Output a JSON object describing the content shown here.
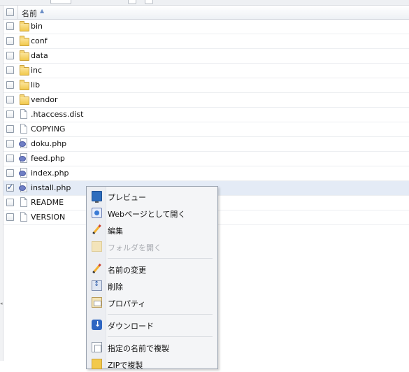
{
  "header": {
    "name_column": "名前",
    "sort_indicator": "▲"
  },
  "files": [
    {
      "name": "bin",
      "type": "folder",
      "checked": false
    },
    {
      "name": "conf",
      "type": "folder",
      "checked": false
    },
    {
      "name": "data",
      "type": "folder",
      "checked": false
    },
    {
      "name": "inc",
      "type": "folder",
      "checked": false
    },
    {
      "name": "lib",
      "type": "folder",
      "checked": false
    },
    {
      "name": "vendor",
      "type": "folder",
      "checked": false
    },
    {
      "name": ".htaccess.dist",
      "type": "file",
      "checked": false
    },
    {
      "name": "COPYING",
      "type": "file",
      "checked": false
    },
    {
      "name": "doku.php",
      "type": "php",
      "checked": false
    },
    {
      "name": "feed.php",
      "type": "php",
      "checked": false
    },
    {
      "name": "index.php",
      "type": "php",
      "checked": false
    },
    {
      "name": "install.php",
      "type": "php",
      "checked": true
    },
    {
      "name": "README",
      "type": "file",
      "checked": false
    },
    {
      "name": "VERSION",
      "type": "file",
      "checked": false
    }
  ],
  "context_menu": {
    "items": [
      {
        "label": "プレビュー",
        "icon": "monitor-icon",
        "enabled": true
      },
      {
        "label": "Webページとして開く",
        "icon": "web-page-icon",
        "enabled": true
      },
      {
        "label": "編集",
        "icon": "pencil-icon",
        "enabled": true
      },
      {
        "label": "フォルダを開く",
        "icon": "folder-open-icon",
        "enabled": false
      },
      {
        "label": "名前の変更",
        "icon": "rename-pencil-icon",
        "enabled": true
      },
      {
        "label": "削除",
        "icon": "delete-icon",
        "enabled": true
      },
      {
        "label": "プロパティ",
        "icon": "properties-icon",
        "enabled": true
      },
      {
        "label": "ダウンロード",
        "icon": "download-icon",
        "enabled": true
      },
      {
        "label": "指定の名前で複製",
        "icon": "copy-icon",
        "enabled": true
      },
      {
        "label": "ZIPで複製",
        "icon": "zip-icon",
        "enabled": true
      }
    ]
  }
}
